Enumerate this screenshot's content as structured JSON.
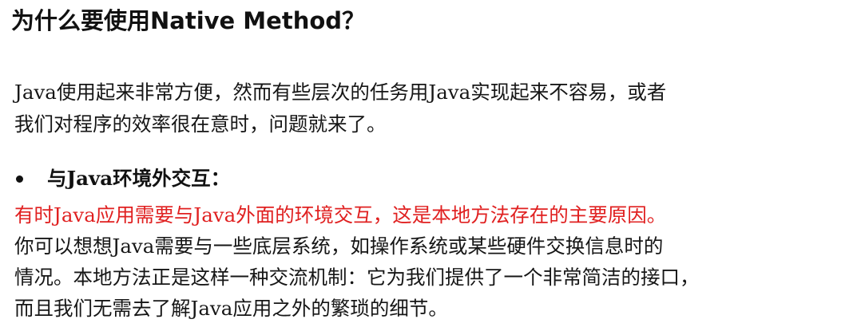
{
  "heading": "为什么要使用Native Method？",
  "intro": {
    "line1": "Java使用起来非常方便，然而有些层次的任务用Java实现起来不容易，或者",
    "line2": "我们对程序的效率很在意时，问题就来了。"
  },
  "bullet": {
    "label": "与Java环境外交互："
  },
  "detail": {
    "highlight": "有时Java应用需要与Java外面的环境交互，这是本地方法存在的主要原因。",
    "line2": "你可以想想Java需要与一些底层系统，如操作系统或某些硬件交换信息时的",
    "line3": "情况。本地方法正是这样一种交流机制：它为我们提供了一个非常简洁的接口，",
    "line4": "而且我们无需去了解Java应用之外的繁琐的细节。"
  },
  "colors": {
    "highlight": "#e02020",
    "text": "#111111",
    "background": "#ffffff"
  }
}
